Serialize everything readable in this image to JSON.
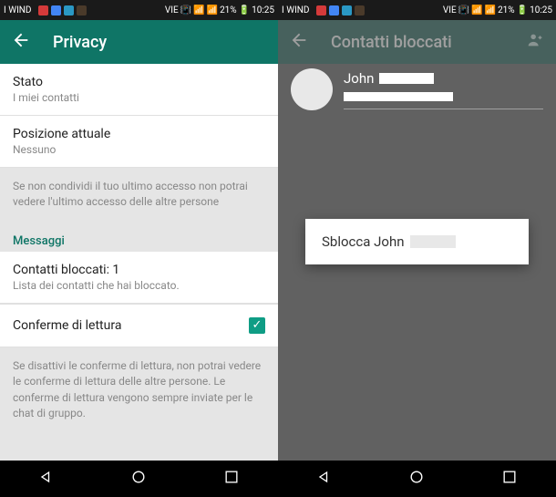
{
  "status": {
    "carrier": "I WIND",
    "battery": "21%",
    "time": "10:25",
    "network": "VIE"
  },
  "privacy": {
    "title": "Privacy",
    "state_label": "Stato",
    "state_value": "I miei contatti",
    "location_label": "Posizione attuale",
    "location_value": "Nessuno",
    "lastseen_hint": "Se non condividi il tuo ultimo accesso non potrai vedere l'ultimo accesso delle altre persone",
    "messages_header": "Messaggi",
    "blocked_label": "Contatti bloccati: 1",
    "blocked_sub": "Lista dei contatti che hai bloccato.",
    "read_receipts_label": "Conferme di lettura",
    "read_receipts_checked": true,
    "read_receipts_hint": "Se disattivi le conferme di lettura, non potrai vedere le conferme di lettura delle altre persone. Le conferme di lettura vengono sempre inviate per le chat di gruppo."
  },
  "blocked": {
    "title": "Contatti bloccati",
    "contact_name": "John",
    "menu_action": "Sblocca John"
  }
}
